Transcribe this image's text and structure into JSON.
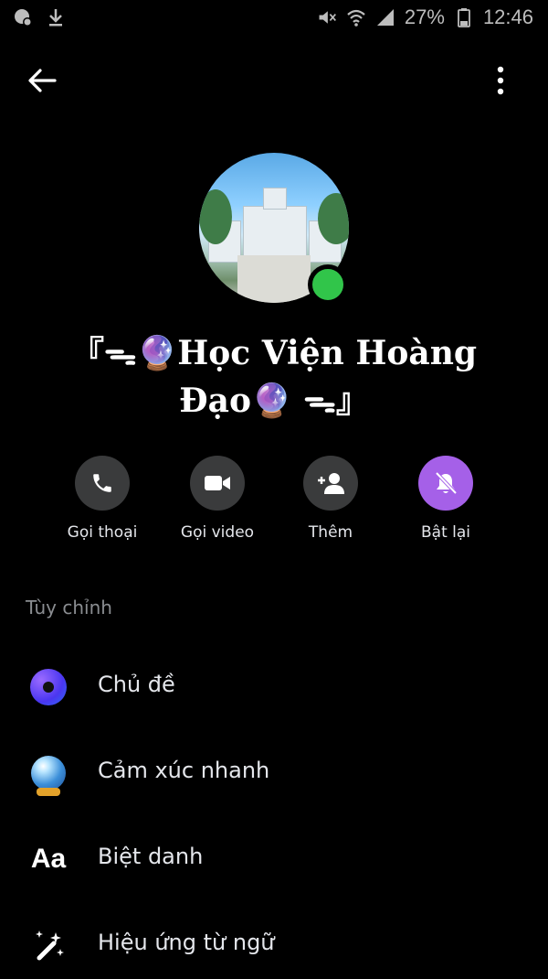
{
  "status_bar": {
    "battery": "27%",
    "time": "12:46"
  },
  "profile": {
    "title_line1": "『ᯓ🔮Học Viện Hoàng",
    "title_line2": "Đạo🔮 ᯓ』"
  },
  "actions": [
    {
      "label": "Gọi thoại",
      "icon": "phone-icon"
    },
    {
      "label": "Gọi video",
      "icon": "video-icon"
    },
    {
      "label": "Thêm",
      "icon": "add-person-icon"
    },
    {
      "label": "Bật lại",
      "icon": "bell-off-icon"
    }
  ],
  "section": {
    "title": "Tùy chỉnh",
    "items": [
      {
        "label": "Chủ đề",
        "icon": "theme-icon"
      },
      {
        "label": "Cảm xúc nhanh",
        "icon": "crystal-ball-emoji-icon"
      },
      {
        "label": "Biệt danh",
        "icon": "nickname-aa-icon",
        "icon_text": "Aa"
      },
      {
        "label": "Hiệu ứng từ ngữ",
        "icon": "magic-wand-icon"
      }
    ]
  },
  "colors": {
    "background": "#000000",
    "button_bg": "#3a3b3c",
    "accent_purple": "#a560e8",
    "online": "#31c54a",
    "muted_text": "#8a8d91"
  }
}
